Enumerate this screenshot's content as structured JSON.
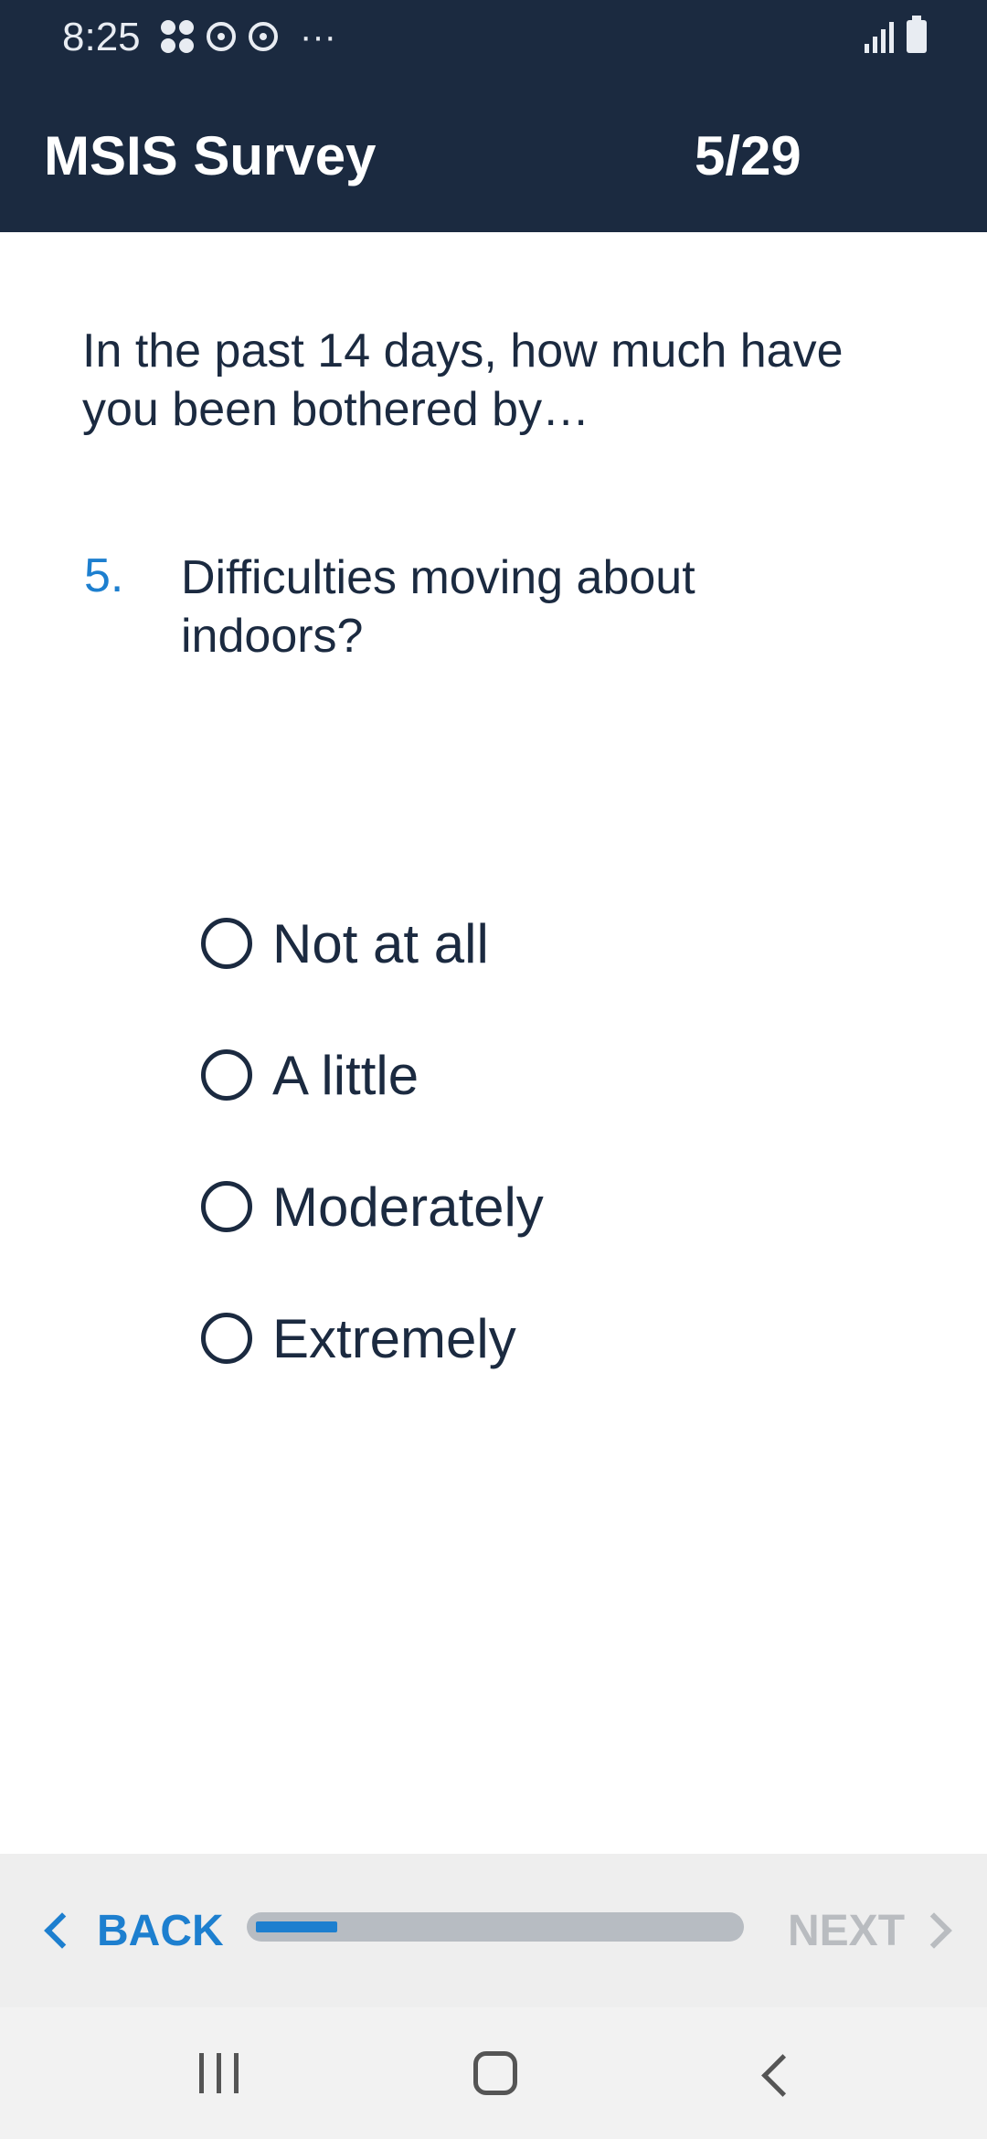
{
  "status_bar": {
    "time": "8:25",
    "icons": [
      "apps-icon",
      "sync-icon",
      "sync-icon",
      "more-icon"
    ],
    "right_icons": [
      "signal-icon",
      "battery-icon"
    ]
  },
  "header": {
    "title": "MSIS Survey",
    "progress_text": "5/29"
  },
  "question": {
    "intro": "In the past 14 days, how much have you been bothered by…",
    "number": "5.",
    "text": "Difficulties moving about indoors?"
  },
  "options": [
    {
      "label": "Not at all",
      "selected": false
    },
    {
      "label": "A little",
      "selected": false
    },
    {
      "label": "Moderately",
      "selected": false
    },
    {
      "label": "Extremely",
      "selected": false
    }
  ],
  "footer": {
    "back_label": "BACK",
    "next_label": "NEXT",
    "progress_fraction": 0.17,
    "next_enabled": false
  },
  "colors": {
    "header_bg": "#1b2a40",
    "accent": "#1d7fcf",
    "text": "#1b2a40",
    "disabled": "#b9bcc0"
  }
}
